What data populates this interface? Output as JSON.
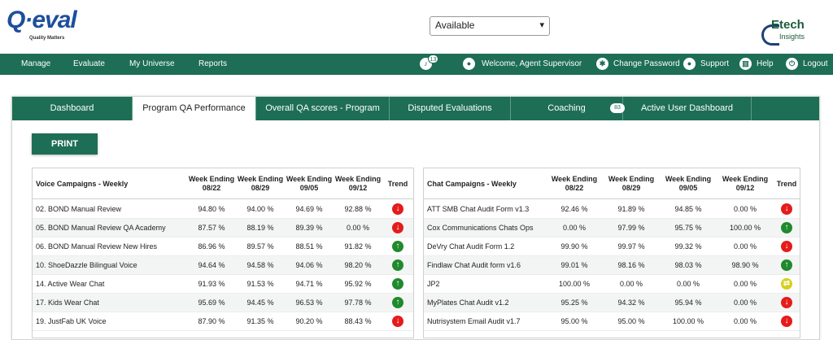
{
  "brand": {
    "logo_word": "Q·eval",
    "tagline": "Quality Matters",
    "partner_line1": "Etech",
    "partner_line2": "Insights"
  },
  "status": {
    "selected": "Available"
  },
  "nav": {
    "manage": "Manage",
    "evaluate": "Evaluate",
    "my_universe": "My Universe",
    "reports": "Reports",
    "notifications_count": "13",
    "welcome": "Welcome, Agent Supervisor",
    "change_password": "Change Password",
    "support": "Support",
    "help": "Help",
    "logout": "Logout"
  },
  "tabs": [
    {
      "label": "Dashboard"
    },
    {
      "label": "Program QA Performance"
    },
    {
      "label": "Overall QA scores - Program"
    },
    {
      "label": "Disputed Evaluations"
    },
    {
      "label": "Coaching",
      "badge": "83"
    },
    {
      "label": "Active User Dashboard"
    }
  ],
  "print_label": "PRINT",
  "voice": {
    "headers": [
      "Voice Campaigns - Weekly",
      "Week Ending 08/22",
      "Week Ending 08/29",
      "Week Ending 09/05",
      "Week Ending 09/12",
      "Trend"
    ],
    "rows": [
      {
        "name": "02. BOND Manual Review",
        "v": [
          "94.80 %",
          "94.00 %",
          "94.69 %",
          "92.88 %"
        ],
        "trend": "down"
      },
      {
        "name": "05. BOND Manual Review QA Academy",
        "v": [
          "87.57 %",
          "88.19 %",
          "89.39 %",
          "0.00 %"
        ],
        "trend": "down"
      },
      {
        "name": "06. BOND Manual Review New Hires",
        "v": [
          "86.96 %",
          "89.57 %",
          "88.51 %",
          "91.82 %"
        ],
        "trend": "up"
      },
      {
        "name": "10. ShoeDazzle Bilingual Voice",
        "v": [
          "94.64 %",
          "94.58 %",
          "94.06 %",
          "98.20 %"
        ],
        "trend": "up"
      },
      {
        "name": "14. Active Wear Chat",
        "v": [
          "91.93 %",
          "91.53 %",
          "94.71 %",
          "95.92 %"
        ],
        "trend": "up"
      },
      {
        "name": "17. Kids Wear Chat",
        "v": [
          "95.69 %",
          "94.45 %",
          "96.53 %",
          "97.78 %"
        ],
        "trend": "up"
      },
      {
        "name": "19. JustFab UK Voice",
        "v": [
          "87.90 %",
          "91.35 %",
          "90.20 %",
          "88.43 %"
        ],
        "trend": "down"
      }
    ]
  },
  "chat": {
    "headers": [
      "Chat Campaigns - Weekly",
      "Week Ending 08/22",
      "Week Ending 08/29",
      "Week Ending 09/05",
      "Week Ending 09/12",
      "Trend"
    ],
    "rows": [
      {
        "name": "ATT SMB Chat Audit Form v1.3",
        "v": [
          "92.46 %",
          "91.89 %",
          "94.85 %",
          "0.00 %"
        ],
        "trend": "down"
      },
      {
        "name": "Cox Communications Chats Ops",
        "v": [
          "0.00 %",
          "97.99 %",
          "95.75 %",
          "100.00 %"
        ],
        "trend": "up"
      },
      {
        "name": "DeVry Chat Audit Form 1.2",
        "v": [
          "99.90 %",
          "99.97 %",
          "99.32 %",
          "0.00 %"
        ],
        "trend": "down"
      },
      {
        "name": "Findlaw Chat Audit form v1.6",
        "v": [
          "99.01 %",
          "98.16 %",
          "98.03 %",
          "98.90 %"
        ],
        "trend": "up"
      },
      {
        "name": "JP2",
        "v": [
          "100.00 %",
          "0.00 %",
          "0.00 %",
          "0.00 %"
        ],
        "trend": "flat"
      },
      {
        "name": "MyPlates Chat Audit v1.2",
        "v": [
          "95.25 %",
          "94.32 %",
          "95.94 %",
          "0.00 %"
        ],
        "trend": "down"
      },
      {
        "name": "Nutrisystem Email Audit v1.7",
        "v": [
          "95.00 %",
          "95.00 %",
          "100.00 %",
          "0.00 %"
        ],
        "trend": "down"
      }
    ]
  },
  "icons": {
    "down": "arrow-down-icon",
    "up": "arrow-up-icon",
    "flat": "arrow-swap-icon"
  },
  "colors": {
    "primary": "#1d6e55",
    "down": "#e51b1b",
    "up": "#1f8a2c",
    "flat": "#d7cf1b"
  }
}
